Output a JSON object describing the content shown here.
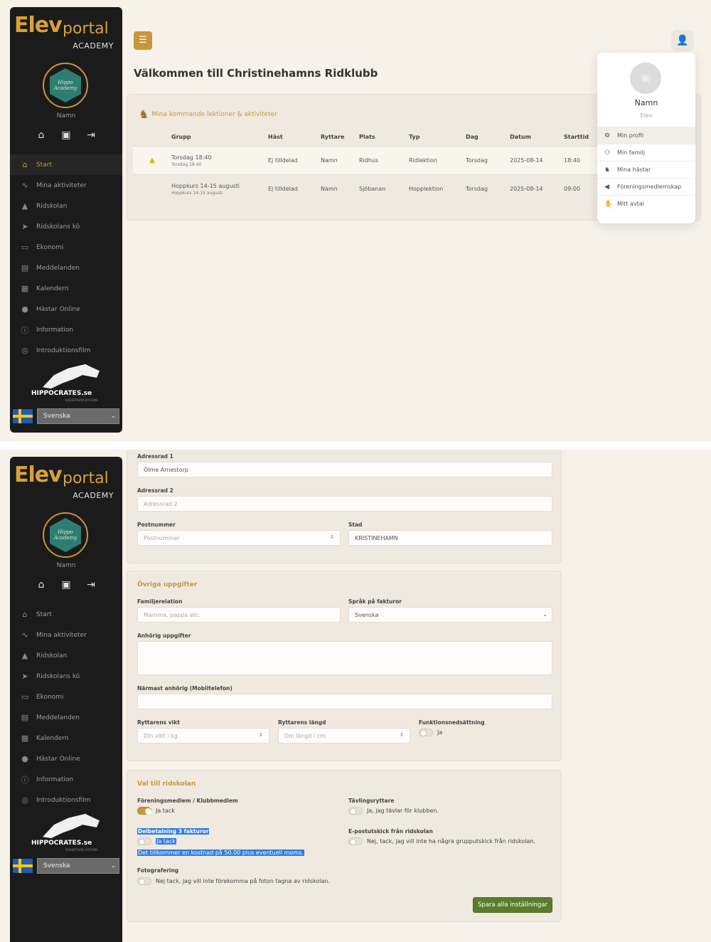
{
  "brand": {
    "elev": "Elev",
    "portal": "portal",
    "academy": "ACADEMY",
    "badge_text": "Hippo Academy",
    "partner": "HIPPOCRATES.se",
    "partner_sub": "EQUESTRIAN SYSTEMS"
  },
  "sidebar": {
    "user_name": "Namn",
    "quick_icons": [
      "home-icon",
      "facebook-icon",
      "logout-icon"
    ],
    "items": [
      {
        "label": "Start",
        "icon": "home-icon"
      },
      {
        "label": "Mina aktiviteter",
        "icon": "pulse-icon"
      },
      {
        "label": "Ridskolan",
        "icon": "graduation-icon"
      },
      {
        "label": "Ridskolans kö",
        "icon": "send-icon"
      },
      {
        "label": "Ekonomi",
        "icon": "money-icon"
      },
      {
        "label": "Meddelanden",
        "icon": "messages-icon"
      },
      {
        "label": "Kalendern",
        "icon": "calendar-icon"
      },
      {
        "label": "Hästar Online",
        "icon": "globe-icon"
      },
      {
        "label": "Information",
        "icon": "info-icon"
      },
      {
        "label": "Introduktionsfilm",
        "icon": "film-icon"
      }
    ],
    "language": "Svenska"
  },
  "header": {
    "welcome": "Välkommen till Christinehamns Ridklubb"
  },
  "lessons": {
    "title": "Mina kommande lektioner & aktiviteter",
    "columns": [
      "Grupp",
      "Häst",
      "Ryttare",
      "Plats",
      "Typ",
      "Dag",
      "Datum",
      "Starttid"
    ],
    "rows": [
      {
        "grupp": "Torsdag 18:40",
        "grupp_sub": "Torsdag 18:40",
        "hast": "Ej tilldelad",
        "ryttare": "Namn",
        "plats": "Ridhus",
        "typ": "Ridlektion",
        "dag": "Torsdag",
        "datum": "2025-08-14",
        "starttid": "18:40"
      },
      {
        "grupp": "Hoppkurs 14-15 augusti",
        "grupp_sub": "Hoppkurs 14-15 augusti",
        "hast": "Ej tilldelad",
        "ryttare": "Namn",
        "plats": "Sjöbanan",
        "typ": "Hopplektion",
        "dag": "Torsdag",
        "datum": "2025-08-14",
        "starttid": "09:00"
      }
    ]
  },
  "profile_menu": {
    "name": "Namn",
    "role": "Elev",
    "items": [
      {
        "label": "Min profil",
        "icon": "gear-icon"
      },
      {
        "label": "Min familj",
        "icon": "family-icon"
      },
      {
        "label": "Mina hästar",
        "icon": "horse-icon"
      },
      {
        "label": "Föreningsmedlemskap",
        "icon": "megaphone-icon"
      },
      {
        "label": "Mitt avtal",
        "icon": "handshake-icon"
      }
    ]
  },
  "address": {
    "line1_label": "Adressrad 1",
    "line1_value": "Ölme Arnestorp",
    "line2_label": "Adressrad 2",
    "line2_placeholder": "Adressrad 2",
    "zip_label": "Postnummer",
    "zip_placeholder": "Postnummer",
    "city_label": "Stad",
    "city_value": "KRISTINEHAMN"
  },
  "other": {
    "title": "Övriga uppgifter",
    "family_label": "Familjerelation",
    "family_placeholder": "Mamma, pappa etc.",
    "invoice_lang_label": "Språk på fakturor",
    "invoice_lang_value": "Svenska",
    "relative_label": "Anhörig uppgifter",
    "nearest_label": "Närmast anhörig (Mobiltelefon)",
    "weight_label": "Ryttarens vikt",
    "weight_placeholder": "Din vikt i kg.",
    "height_label": "Ryttarens längd",
    "height_placeholder": "Din längd i cm.",
    "disability_label": "Funktionsnedsättning",
    "disability_option": "Ja"
  },
  "school": {
    "title": "Val till ridskolan",
    "member_label": "Föreningsmedlem / Klubbmedlem",
    "member_option": "Ja tack",
    "competitor_label": "Tävlingsryttare",
    "competitor_option": "Ja, jag tävlar för klubben.",
    "installment_label": "Delbetalning 3 fakturor",
    "installment_option": "Ja tack",
    "installment_note": "Det tillkommer en kostnad på 50.00 plus eventuell moms.",
    "email_label": "E-postutskick från ridskolan",
    "email_option": "Nej, tack, jag vill inte ha några grupputskick från ridskolan.",
    "photo_label": "Fotografering",
    "photo_option": "Nej tack, jag vill inte förekomma på foton tagna av ridskolan.",
    "save_label": "Spara alla inställningar"
  },
  "colors": {
    "accent": "#c8963a",
    "sidebar_bg": "#1b1b1b",
    "save_green": "#5a7d2c",
    "page_bg": "#f6f2ea"
  }
}
